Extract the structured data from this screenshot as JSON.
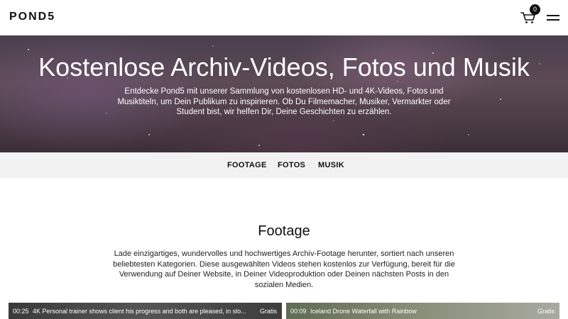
{
  "header": {
    "logo": "POND5",
    "cart_count": "0"
  },
  "hero": {
    "title": "Kostenlose Archiv-Videos, Fotos und Musik",
    "description": "Entdecke Pond5 mit unserer Sammlung von kostenlosen HD- und 4K-Videos, Fotos und Musiktiteln, um Dein Publikum zu inspirieren. Ob Du Filmemacher, Musiker, Vermarkter oder Student bist, wir helfen Dir, Deine Geschichten zu erzählen."
  },
  "category_nav": {
    "items": [
      {
        "label": "FOOTAGE"
      },
      {
        "label": "FOTOS"
      },
      {
        "label": "MUSIK"
      }
    ]
  },
  "footage_section": {
    "title": "Footage",
    "description": "Lade einzigartiges, wundervolles und hochwertiges Archiv-Footage herunter, sortiert nach unseren beliebtesten Kategorien. Diese ausgewählten Videos stehen kostenlos zur Verfügung, bereit für die Verwendung auf Deiner Website, in Deiner Videoproduktion oder Deinen nächsten Posts in den sozialen Medien."
  },
  "clips": [
    {
      "duration": "00:25",
      "title": "4K Personal trainer shows client his progress and both are pleased, in slo...",
      "price": "Gratis"
    },
    {
      "duration": "00:09",
      "title": "Iceland Drone Waterfall with Rainbow",
      "price": "Gratis"
    }
  ],
  "icons": {
    "cart": "cart-icon",
    "menu": "hamburger-menu-icon"
  }
}
